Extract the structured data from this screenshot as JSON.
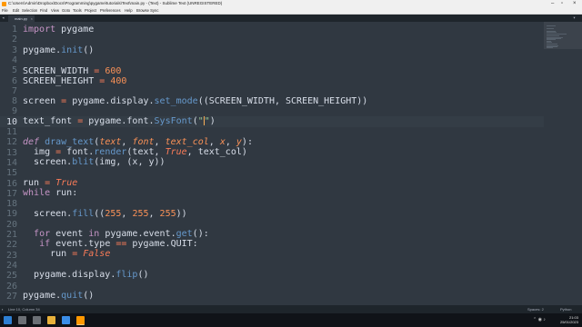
{
  "window": {
    "title": "C:\\Users\\Admin\\Dropbox\\Docs\\Programming\\pygame\\tutorials\\Text\\main.py - (Text) - Sublime Text (UNREGISTERED)"
  },
  "menu": [
    "File",
    "Edit",
    "Selection",
    "Find",
    "View",
    "Goto",
    "Tools",
    "Project",
    "Preferences",
    "Help",
    "Browse Sync"
  ],
  "tab": {
    "label": "main.py"
  },
  "code": {
    "line_numbers": [
      "1",
      "2",
      "3",
      "4",
      "5",
      "6",
      "7",
      "8",
      "9",
      "10",
      "11",
      "12",
      "13",
      "14",
      "15",
      "16",
      "17",
      "18",
      "19",
      "20",
      "21",
      "22",
      "23",
      "24",
      "25",
      "26",
      "27"
    ],
    "current_line": "10"
  },
  "status": {
    "left": "Line 10, Column 34",
    "spaces": "Spaces: 2",
    "syntax": "Python"
  },
  "taskbar": {
    "time": "21:03",
    "date": "25/01/2023"
  },
  "colors": {
    "background": "#303841",
    "keyword": "#c594c5",
    "function": "#6699cc",
    "number": "#f99157",
    "string": "#99c794"
  }
}
